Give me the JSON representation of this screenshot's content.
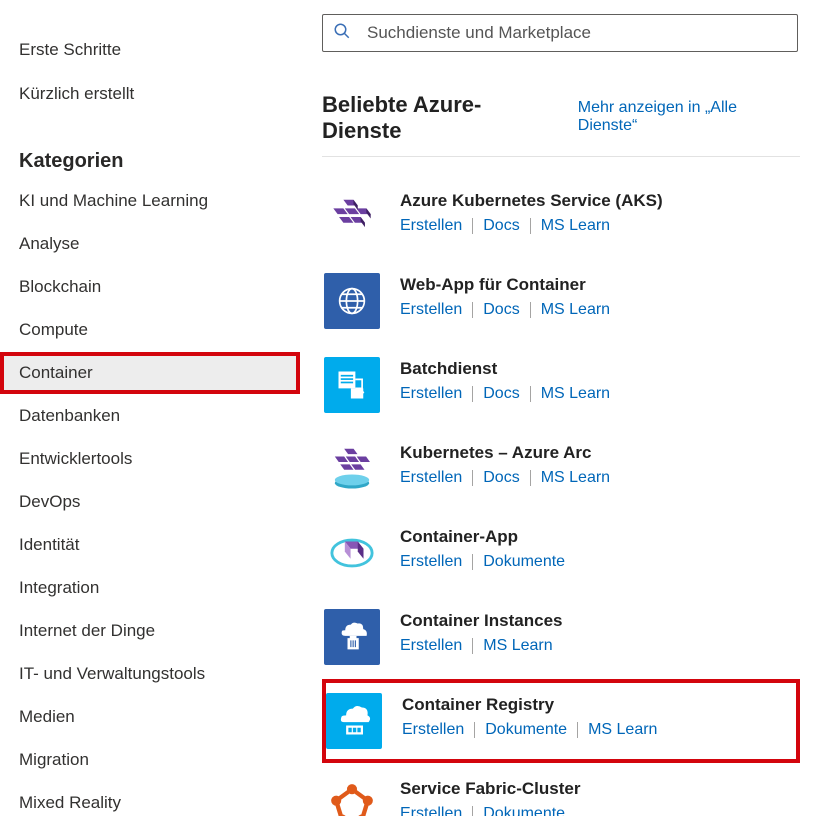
{
  "sidebar": {
    "top_links": [
      {
        "label": "Erste Schritte"
      },
      {
        "label": "Kürzlich erstellt"
      }
    ],
    "categories_heading": "Kategorien",
    "categories": [
      {
        "label": "KI und Machine Learning",
        "selected": false
      },
      {
        "label": "Analyse",
        "selected": false
      },
      {
        "label": "Blockchain",
        "selected": false
      },
      {
        "label": "Compute",
        "selected": false
      },
      {
        "label": "Container",
        "selected": true
      },
      {
        "label": "Datenbanken",
        "selected": false
      },
      {
        "label": "Entwicklertools",
        "selected": false
      },
      {
        "label": "DevOps",
        "selected": false
      },
      {
        "label": "Identität",
        "selected": false
      },
      {
        "label": "Integration",
        "selected": false
      },
      {
        "label": "Internet der Dinge",
        "selected": false
      },
      {
        "label": "IT- und Verwaltungstools",
        "selected": false
      },
      {
        "label": "Medien",
        "selected": false
      },
      {
        "label": "Migration",
        "selected": false
      },
      {
        "label": "Mixed Reality",
        "selected": false
      }
    ]
  },
  "search": {
    "placeholder": "Suchdienste und Marketplace"
  },
  "section": {
    "title": "Beliebte Azure-Dienste",
    "see_all": "Mehr anzeigen in „Alle Dienste“"
  },
  "services": [
    {
      "name": "Azure Kubernetes Service (AKS)",
      "links": [
        "Erstellen",
        "Docs",
        "MS Learn"
      ],
      "icon": "aks",
      "bg": "transparent",
      "highlight": false
    },
    {
      "name": "Web-App für Container",
      "links": [
        "Erstellen",
        "Docs",
        "MS Learn"
      ],
      "icon": "webapp",
      "bg": "#2f5faa",
      "highlight": false
    },
    {
      "name": "Batchdienst",
      "links": [
        "Erstellen",
        "Docs",
        "MS Learn"
      ],
      "icon": "batch",
      "bg": "#00abec",
      "highlight": false
    },
    {
      "name": "Kubernetes – Azure Arc",
      "links": [
        "Erstellen",
        "Docs",
        "MS Learn"
      ],
      "icon": "arc",
      "bg": "transparent",
      "highlight": false
    },
    {
      "name": "Container-App",
      "links": [
        "Erstellen",
        "Dokumente"
      ],
      "icon": "capp",
      "bg": "transparent",
      "highlight": false
    },
    {
      "name": "Container Instances",
      "links": [
        "Erstellen",
        "MS Learn"
      ],
      "icon": "ci",
      "bg": "#2f5faa",
      "highlight": false
    },
    {
      "name": "Container Registry",
      "links": [
        "Erstellen",
        "Dokumente",
        "MS Learn"
      ],
      "icon": "cr",
      "bg": "#00abec",
      "highlight": true
    },
    {
      "name": "Service Fabric-Cluster",
      "links": [
        "Erstellen",
        "Dokumente"
      ],
      "icon": "sf",
      "bg": "transparent",
      "highlight": false
    }
  ],
  "icons": {
    "aks": "<svg width='46' height='46' viewBox='0 0 64 64'><g fill='#6b3fa0'><polygon points='20,8 34,8 40,16 26,16'/><polygon points='6,20 20,20 26,28 12,28'/><polygon points='22,20 36,20 42,28 28,28'/><polygon points='38,20 52,20 58,28 44,28'/><polygon points='14,32 28,32 34,40 20,40'/><polygon points='30,32 44,32 50,40 36,40'/></g><g fill='#3f2063'><polygon points='34,8 40,16 40,22 34,14'/><polygon points='52,20 58,28 58,34 52,26'/><polygon points='44,32 50,40 50,46 44,38'/></g></svg>",
    "webapp": "<svg width='36' height='36' viewBox='0 0 64 64'><circle cx='32' cy='32' r='22' fill='none' stroke='#fff' stroke-width='3'/><ellipse cx='32' cy='32' rx='10' ry='22' fill='none' stroke='#fff' stroke-width='3'/><line x1='10' y1='32' x2='54' y2='32' stroke='#fff' stroke-width='3'/><line x1='14' y1='20' x2='50' y2='20' stroke='#fff' stroke-width='3'/><line x1='14' y1='44' x2='50' y2='44' stroke='#fff' stroke-width='3'/></svg>",
    "batch": "<svg width='36' height='36' viewBox='0 0 64 64'><rect x='8' y='8' width='30' height='30' fill='#fff'/><rect x='12' y='14' width='22' height='3' fill='#00abec'/><rect x='12' y='20' width='22' height='3' fill='#00abec'/><rect x='12' y='26' width='22' height='3' fill='#00abec'/><path d='M38 22 L50 22 L50 38 L38 38' fill='none' stroke='#fff' stroke-width='3'/><polygon points='36,42 46,42 46,36 54,45 46,54 46,48 36,48' fill='#fff'/><rect x='30' y='38' width='22' height='18' fill='#fff'/></svg>",
    "arc": "<svg width='50' height='50' viewBox='0 0 64 64'><ellipse cx='32' cy='50' rx='22' ry='7' fill='#30a7c7'/><ellipse cx='32' cy='46' rx='22' ry='7' fill='#6ed0eb'/><g fill='#6b3fa0'><polygon points='22,6 34,6 39,13 27,13'/><polygon points='10,16 22,16 27,23 15,23'/><polygon points='24,16 36,16 41,23 29,23'/><polygon points='38,16 50,16 55,23 43,23'/><polygon points='17,26 29,26 34,33 22,33'/><polygon points='31,26 43,26 48,33 36,33'/></g></svg>",
    "capp": "<svg width='46' height='46' viewBox='0 0 64 64'><ellipse cx='32' cy='32' rx='28' ry='18' fill='none' stroke='#42c3dd' stroke-width='4'/><g><polygon points='22,16 40,16 48,26 30,26' fill='#8856b5'/><polygon points='40,16 48,26 48,40 40,30' fill='#5a2e86'/><polygon points='22,16 30,26 30,40 22,30' fill='#b78fd6'/></g></svg>",
    "ci": "<svg width='36' height='36' viewBox='0 0 64 64'><path d='M20 20 Q20 10 30 10 Q34 4 42 8 Q52 6 52 18 Q60 20 58 30 L20 30 Q12 30 14 22 Q14 20 20 20 Z' fill='#fff'/><rect x='24' y='34' width='20' height='20' fill='#fff'/><rect x='28' y='30' width='12' height='6' fill='#fff'/><line x1='30' y1='38' x2='30' y2='50' stroke='#2f5faa' stroke-width='2'/><line x1='34' y1='38' x2='34' y2='50' stroke='#2f5faa' stroke-width='2'/><line x1='38' y1='38' x2='38' y2='50' stroke='#2f5faa' stroke-width='2'/></svg>",
    "cr": "<svg width='36' height='36' viewBox='0 0 64 64'><path d='M18 22 Q18 10 30 10 Q36 2 46 8 Q58 8 56 22 Q64 26 58 34 L14 34 Q6 34 10 24 Q12 22 18 22 Z' fill='#fff'/><rect x='18' y='40' width='30' height='16' fill='#fff'/><rect x='22' y='44' width='6' height='8' fill='#00abec'/><rect x='30' y='44' width='6' height='8' fill='#00abec'/><rect x='38' y='44' width='6' height='8' fill='#00abec'/></svg>",
    "sf": "<svg width='46' height='46' viewBox='0 0 64 64'><g fill='#e05a1a'><circle cx='32' cy='10' r='7'/><circle cx='54' cy='26' r='7'/><circle cx='46' cy='52' r='7'/><circle cx='18' cy='52' r='7'/><circle cx='10' cy='26' r='7'/></g><g stroke='#e05a1a' stroke-width='6' fill='none'><line x1='32' y1='10' x2='54' y2='26'/><line x1='54' y1='26' x2='46' y2='52'/><line x1='46' y1='52' x2='18' y2='52'/><line x1='18' y1='52' x2='10' y2='26'/><line x1='10' y1='26' x2='32' y2='10'/></g></svg>"
  }
}
